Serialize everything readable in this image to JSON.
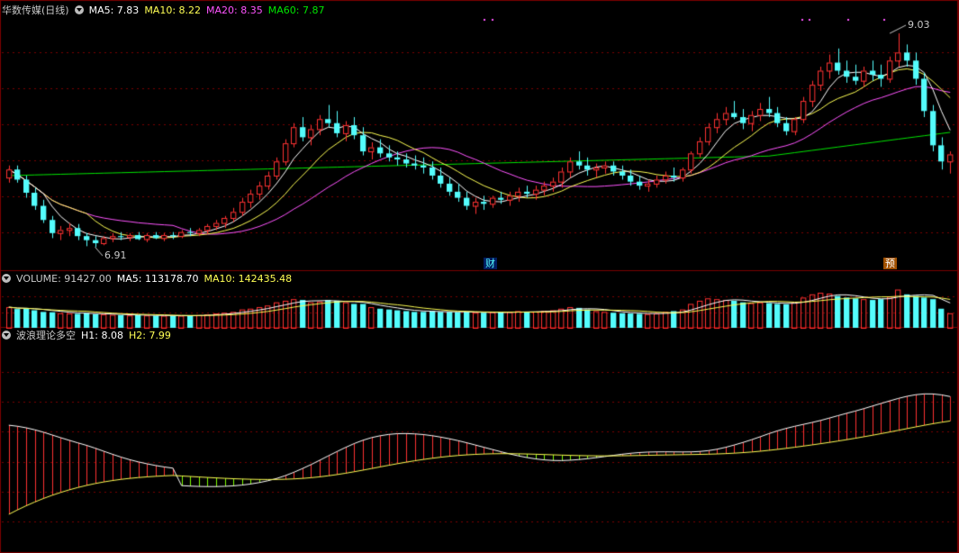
{
  "colors": {
    "background": "#000000",
    "up": "#ff3232",
    "down": "#54fcfc",
    "ma5": "#ffffff",
    "ma10": "#ffff54",
    "ma20": "#ff54ff",
    "ma60": "#00e600",
    "grid": "#7a0000",
    "wave_green": "#7fff00",
    "wave_red": "#ff3232",
    "h2_line": "#ffff54",
    "label_gray": "#c8c8c8"
  },
  "price_panel": {
    "title": "华数传媒(日线)",
    "ma5": "MA5: 7.83",
    "ma10": "MA10: 8.22",
    "ma20": "MA20: 8.35",
    "ma60": "MA60: 7.87",
    "high_label": "9.03",
    "low_label": "6.91",
    "marker_cai": "财",
    "marker_yu": "预"
  },
  "volume_panel": {
    "volume": "VOLUME: 91427.00",
    "ma5": "MA5: 113178.70",
    "ma10": "MA10: 142435.48"
  },
  "wave_panel": {
    "title": "波浪理论多空",
    "h1": "H1: 8.08",
    "h2": "H2: 7.99"
  },
  "chart_data": {
    "type": "candlestick",
    "price_range": [
      6.7,
      9.2
    ],
    "volume_max": 260000,
    "wave_range": [
      6.0,
      9.4
    ],
    "candles": [
      [
        7.6,
        7.72,
        7.55,
        7.68,
        130000
      ],
      [
        7.68,
        7.72,
        7.55,
        7.58,
        118000
      ],
      [
        7.58,
        7.62,
        7.4,
        7.45,
        120000
      ],
      [
        7.45,
        7.5,
        7.28,
        7.32,
        110000
      ],
      [
        7.32,
        7.38,
        7.15,
        7.18,
        100000
      ],
      [
        7.18,
        7.22,
        7.0,
        7.05,
        98000
      ],
      [
        7.05,
        7.12,
        6.98,
        7.08,
        92000
      ],
      [
        7.08,
        7.15,
        7.02,
        7.1,
        90000
      ],
      [
        7.1,
        7.14,
        6.98,
        7.02,
        88000
      ],
      [
        7.02,
        7.05,
        6.92,
        6.98,
        92000
      ],
      [
        6.98,
        7.02,
        6.91,
        6.95,
        86000
      ],
      [
        6.95,
        7.02,
        6.93,
        7.0,
        84000
      ],
      [
        7.0,
        7.05,
        6.96,
        7.02,
        82000
      ],
      [
        7.02,
        7.06,
        6.98,
        7.01,
        80000
      ],
      [
        7.01,
        7.05,
        6.97,
        7.03,
        78000
      ],
      [
        7.03,
        7.06,
        6.98,
        6.99,
        80000
      ],
      [
        6.99,
        7.05,
        6.96,
        7.03,
        78000
      ],
      [
        7.03,
        7.06,
        6.99,
        7.0,
        76000
      ],
      [
        7.0,
        7.05,
        6.97,
        7.03,
        76000
      ],
      [
        7.03,
        7.06,
        6.99,
        7.02,
        74000
      ],
      [
        7.02,
        7.08,
        7.0,
        7.06,
        76000
      ],
      [
        7.06,
        7.1,
        7.02,
        7.05,
        78000
      ],
      [
        7.05,
        7.1,
        7.02,
        7.08,
        80000
      ],
      [
        7.08,
        7.14,
        7.04,
        7.12,
        84000
      ],
      [
        7.12,
        7.18,
        7.08,
        7.15,
        90000
      ],
      [
        7.15,
        7.22,
        7.1,
        7.2,
        95000
      ],
      [
        7.2,
        7.3,
        7.16,
        7.26,
        100000
      ],
      [
        7.26,
        7.4,
        7.22,
        7.36,
        115000
      ],
      [
        7.36,
        7.48,
        7.3,
        7.44,
        120000
      ],
      [
        7.44,
        7.56,
        7.38,
        7.52,
        130000
      ],
      [
        7.52,
        7.66,
        7.48,
        7.62,
        140000
      ],
      [
        7.62,
        7.8,
        7.58,
        7.76,
        160000
      ],
      [
        7.76,
        7.98,
        7.72,
        7.94,
        170000
      ],
      [
        7.94,
        8.14,
        7.9,
        8.1,
        180000
      ],
      [
        8.1,
        8.2,
        7.96,
        8.0,
        175000
      ],
      [
        8.0,
        8.12,
        7.92,
        8.08,
        160000
      ],
      [
        8.08,
        8.22,
        8.02,
        8.18,
        165000
      ],
      [
        8.18,
        8.32,
        8.1,
        8.14,
        175000
      ],
      [
        8.14,
        8.26,
        8.0,
        8.04,
        170000
      ],
      [
        8.04,
        8.16,
        7.96,
        8.12,
        160000
      ],
      [
        8.12,
        8.2,
        7.98,
        8.02,
        150000
      ],
      [
        8.02,
        8.1,
        7.82,
        7.86,
        150000
      ],
      [
        7.86,
        7.95,
        7.78,
        7.9,
        130000
      ],
      [
        7.9,
        7.98,
        7.8,
        7.84,
        120000
      ],
      [
        7.84,
        7.92,
        7.76,
        7.8,
        115000
      ],
      [
        7.8,
        7.86,
        7.72,
        7.78,
        110000
      ],
      [
        7.78,
        7.84,
        7.7,
        7.74,
        105000
      ],
      [
        7.74,
        7.82,
        7.68,
        7.72,
        100000
      ],
      [
        7.72,
        7.8,
        7.64,
        7.7,
        100000
      ],
      [
        7.7,
        7.76,
        7.58,
        7.62,
        105000
      ],
      [
        7.62,
        7.7,
        7.5,
        7.54,
        100000
      ],
      [
        7.54,
        7.6,
        7.42,
        7.46,
        100000
      ],
      [
        7.46,
        7.54,
        7.36,
        7.4,
        98000
      ],
      [
        7.4,
        7.46,
        7.28,
        7.32,
        100000
      ],
      [
        7.32,
        7.4,
        7.24,
        7.36,
        95000
      ],
      [
        7.36,
        7.42,
        7.28,
        7.34,
        95000
      ],
      [
        7.34,
        7.42,
        7.3,
        7.4,
        98000
      ],
      [
        7.4,
        7.46,
        7.34,
        7.38,
        96000
      ],
      [
        7.38,
        7.46,
        7.32,
        7.42,
        100000
      ],
      [
        7.42,
        7.5,
        7.36,
        7.46,
        105000
      ],
      [
        7.46,
        7.52,
        7.4,
        7.44,
        100000
      ],
      [
        7.44,
        7.52,
        7.38,
        7.48,
        102000
      ],
      [
        7.48,
        7.56,
        7.42,
        7.52,
        106000
      ],
      [
        7.52,
        7.6,
        7.46,
        7.56,
        110000
      ],
      [
        7.56,
        7.7,
        7.5,
        7.66,
        120000
      ],
      [
        7.66,
        7.8,
        7.6,
        7.76,
        130000
      ],
      [
        7.76,
        7.86,
        7.68,
        7.72,
        125000
      ],
      [
        7.72,
        7.8,
        7.62,
        7.68,
        115000
      ],
      [
        7.68,
        7.74,
        7.6,
        7.7,
        105000
      ],
      [
        7.7,
        7.76,
        7.64,
        7.72,
        100000
      ],
      [
        7.72,
        7.76,
        7.62,
        7.66,
        95000
      ],
      [
        7.66,
        7.72,
        7.58,
        7.62,
        92000
      ],
      [
        7.62,
        7.68,
        7.52,
        7.56,
        90000
      ],
      [
        7.56,
        7.62,
        7.48,
        7.52,
        88000
      ],
      [
        7.52,
        7.58,
        7.46,
        7.54,
        86000
      ],
      [
        7.54,
        7.62,
        7.5,
        7.58,
        90000
      ],
      [
        7.58,
        7.66,
        7.54,
        7.62,
        100000
      ],
      [
        7.62,
        7.7,
        7.56,
        7.6,
        105000
      ],
      [
        7.6,
        7.7,
        7.56,
        7.68,
        115000
      ],
      [
        7.68,
        7.86,
        7.64,
        7.84,
        150000
      ],
      [
        7.84,
        8.0,
        7.8,
        7.96,
        170000
      ],
      [
        7.96,
        8.14,
        7.92,
        8.1,
        185000
      ],
      [
        8.1,
        8.24,
        8.04,
        8.18,
        180000
      ],
      [
        8.18,
        8.3,
        8.12,
        8.24,
        175000
      ],
      [
        8.24,
        8.36,
        8.18,
        8.2,
        170000
      ],
      [
        8.2,
        8.28,
        8.08,
        8.14,
        160000
      ],
      [
        8.14,
        8.26,
        8.06,
        8.22,
        155000
      ],
      [
        8.22,
        8.34,
        8.16,
        8.28,
        160000
      ],
      [
        8.28,
        8.4,
        8.2,
        8.24,
        155000
      ],
      [
        8.24,
        8.3,
        8.1,
        8.14,
        150000
      ],
      [
        8.14,
        8.2,
        8.02,
        8.06,
        148000
      ],
      [
        8.06,
        8.2,
        8.02,
        8.18,
        160000
      ],
      [
        8.18,
        8.4,
        8.14,
        8.36,
        190000
      ],
      [
        8.36,
        8.56,
        8.3,
        8.52,
        210000
      ],
      [
        8.52,
        8.7,
        8.46,
        8.66,
        220000
      ],
      [
        8.66,
        8.82,
        8.58,
        8.74,
        215000
      ],
      [
        8.74,
        8.88,
        8.62,
        8.66,
        200000
      ],
      [
        8.66,
        8.76,
        8.54,
        8.6,
        190000
      ],
      [
        8.6,
        8.72,
        8.52,
        8.56,
        185000
      ],
      [
        8.56,
        8.7,
        8.5,
        8.66,
        180000
      ],
      [
        8.66,
        8.76,
        8.56,
        8.62,
        175000
      ],
      [
        8.62,
        8.72,
        8.5,
        8.58,
        180000
      ],
      [
        8.58,
        8.8,
        8.54,
        8.76,
        195000
      ],
      [
        8.76,
        9.03,
        8.7,
        8.84,
        240000
      ],
      [
        8.84,
        8.92,
        8.7,
        8.76,
        210000
      ],
      [
        8.76,
        8.84,
        8.52,
        8.58,
        200000
      ],
      [
        8.58,
        8.64,
        8.2,
        8.26,
        190000
      ],
      [
        8.26,
        8.32,
        7.86,
        7.92,
        180000
      ],
      [
        7.92,
        8.0,
        7.68,
        7.76,
        120000
      ],
      [
        7.76,
        7.86,
        7.64,
        7.83,
        91427
      ]
    ]
  }
}
